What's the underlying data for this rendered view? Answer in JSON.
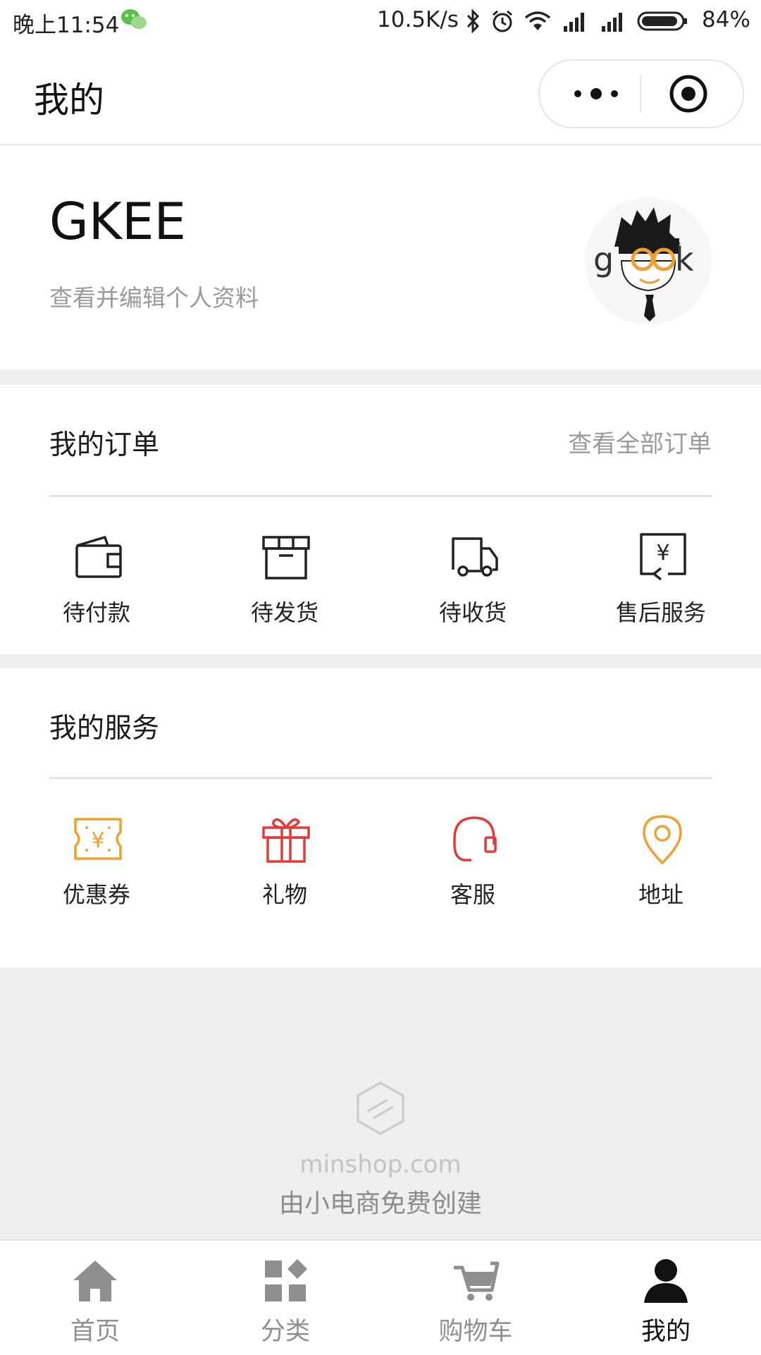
{
  "status_bar": {
    "time": "晚上11:54",
    "network_speed": "10.5K/s",
    "battery_percent": "84%",
    "icons": [
      "wechat-icon",
      "bluetooth-icon",
      "alarm-icon",
      "wifi-icon",
      "signal-icon",
      "signal-icon",
      "battery-icon"
    ]
  },
  "nav": {
    "title": "我的",
    "more_icon": "more-dots-icon",
    "close_icon": "target-close-icon"
  },
  "profile": {
    "username": "GKEE",
    "subtitle": "查看并编辑个人资料",
    "avatar_icon": "geek-avatar"
  },
  "orders": {
    "title": "我的订单",
    "view_all": "查看全部订单",
    "items": [
      {
        "label": "待付款",
        "icon": "wallet-icon"
      },
      {
        "label": "待发货",
        "icon": "box-icon"
      },
      {
        "label": "待收货",
        "icon": "truck-icon"
      },
      {
        "label": "售后服务",
        "icon": "refund-icon"
      }
    ]
  },
  "services": {
    "title": "我的服务",
    "items": [
      {
        "label": "优惠券",
        "icon": "coupon-icon",
        "color": "#f0a030"
      },
      {
        "label": "礼物",
        "icon": "gift-icon",
        "color": "#e33b3b"
      },
      {
        "label": "客服",
        "icon": "headset-icon",
        "color": "#e33b3b"
      },
      {
        "label": "地址",
        "icon": "location-pin-icon",
        "color": "#f0a030"
      }
    ]
  },
  "footer": {
    "domain": "minshop.com",
    "note": "由小电商免费创建"
  },
  "tabbar": {
    "active_index": 3,
    "items": [
      {
        "label": "首页",
        "icon": "home-icon"
      },
      {
        "label": "分类",
        "icon": "category-icon"
      },
      {
        "label": "购物车",
        "icon": "cart-icon"
      },
      {
        "label": "我的",
        "icon": "user-icon"
      }
    ]
  },
  "colors": {
    "accent_orange": "#f0a030",
    "accent_red": "#e33b3b",
    "page_gray": "#eeeff1"
  }
}
